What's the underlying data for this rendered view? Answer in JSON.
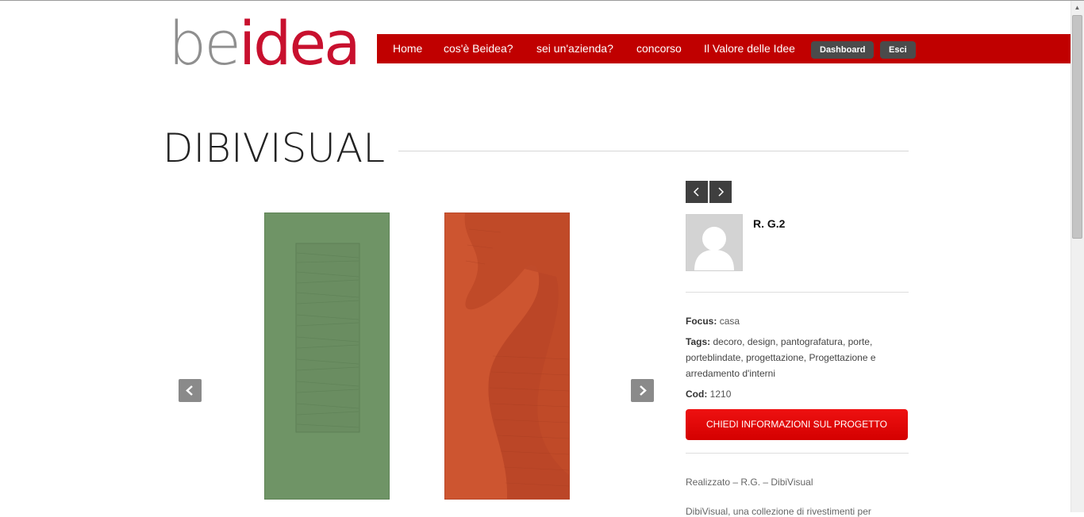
{
  "logo": {
    "part1": "be",
    "part2": "idea"
  },
  "nav": {
    "items": [
      "Home",
      "cos'è Beidea?",
      "sei un'azienda?",
      "concorso",
      "Il Valore delle Idee"
    ],
    "dashboard": "Dashboard",
    "logout": "Esci"
  },
  "page": {
    "title": "DIBIVISUAL"
  },
  "gallery": {
    "prev_icon": "chevron-left-icon",
    "next_icon": "chevron-right-icon"
  },
  "sidebar": {
    "author": "R. G.2",
    "focus_label": "Focus:",
    "focus_value": "casa",
    "tags_label": "Tags:",
    "tags": [
      "decoro",
      "design",
      "pantografatura",
      "porte",
      "porteblindate",
      "progettazione",
      "Progettazione e arredamento d'interni"
    ],
    "code_label": "Cod:",
    "code_value": "1210",
    "cta": "CHIEDI INFORMAZIONI SUL PROGETTO",
    "desc1": "Realizzato – R.G. – DibiVisual",
    "desc2": "DibiVisual, una collezione di rivestimenti per"
  },
  "colors": {
    "brand_red": "#c00000",
    "cta_red": "#e00000",
    "dark_button": "#4b4b4b"
  }
}
